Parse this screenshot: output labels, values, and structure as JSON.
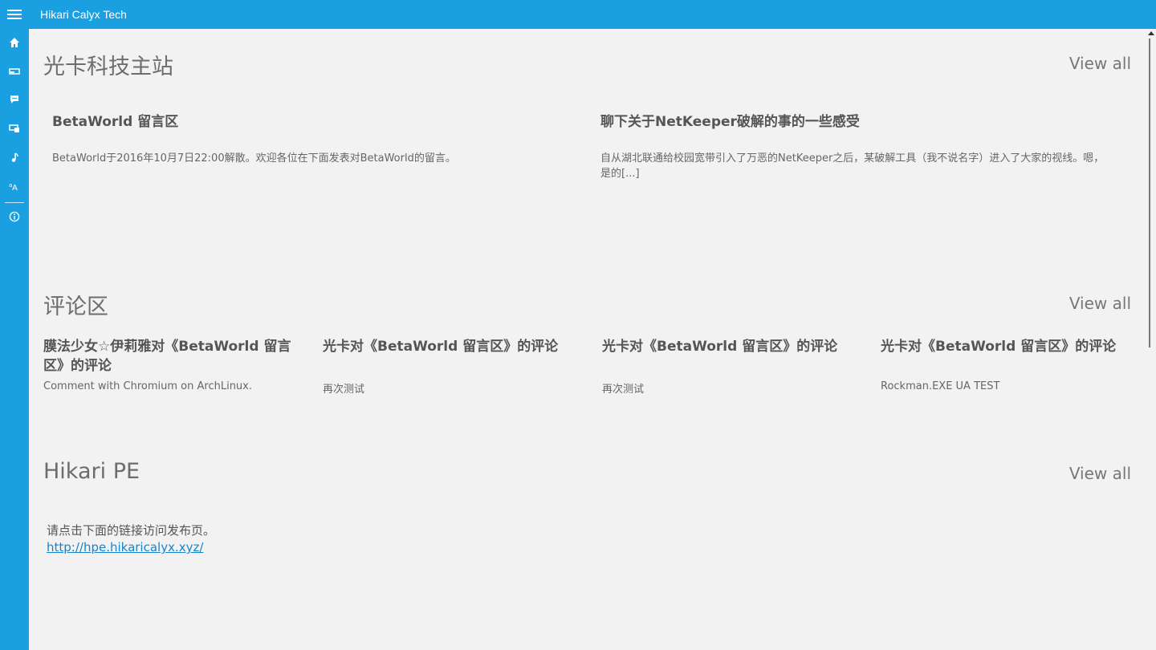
{
  "app": {
    "title": "Hikari Calyx Tech"
  },
  "colors": {
    "accent": "#1aa0e0",
    "background": "#f2f2f2",
    "link": "#1a84c9"
  },
  "sidebar": {
    "items": [
      {
        "icon": "home-icon"
      },
      {
        "icon": "card-icon"
      },
      {
        "icon": "comment-icon"
      },
      {
        "icon": "device-icon"
      },
      {
        "icon": "music-note-icon"
      },
      {
        "icon": "font-size-icon"
      },
      {
        "icon": "info-icon"
      }
    ]
  },
  "sections": {
    "main_site": {
      "title": "光卡科技主站",
      "view_all": "View all",
      "posts": [
        {
          "title": "BetaWorld 留言区",
          "excerpt": "BetaWorld于2016年10月7日22:00解散。欢迎各位在下面发表对BetaWorld的留言。"
        },
        {
          "title": "聊下关于NetKeeper破解的事的一些感受",
          "excerpt_line1": "自从湖北联通给校园宽带引入了万恶的NetKeeper之后，某破解工具（我不说名字）进入了大家的视线。嗯，",
          "excerpt_line2": "是的[...]"
        }
      ]
    },
    "comments": {
      "title": "评论区",
      "view_all": "View all",
      "items": [
        {
          "title": "膜法少女☆伊莉雅对《BetaWorld 留言区》的评论",
          "body": "Comment with Chromium on ArchLinux."
        },
        {
          "title": "光卡对《BetaWorld 留言区》的评论",
          "body": "再次测试"
        },
        {
          "title": "光卡对《BetaWorld 留言区》的评论",
          "body": "再次测试"
        },
        {
          "title": "光卡对《BetaWorld 留言区》的评论",
          "body": "Rockman.EXE UA TEST"
        }
      ]
    },
    "hikari_pe": {
      "title": "Hikari PE",
      "view_all": "View all",
      "text": "请点击下面的链接访问发布页。",
      "link": "http://hpe.hikaricalyx.xyz/"
    }
  }
}
